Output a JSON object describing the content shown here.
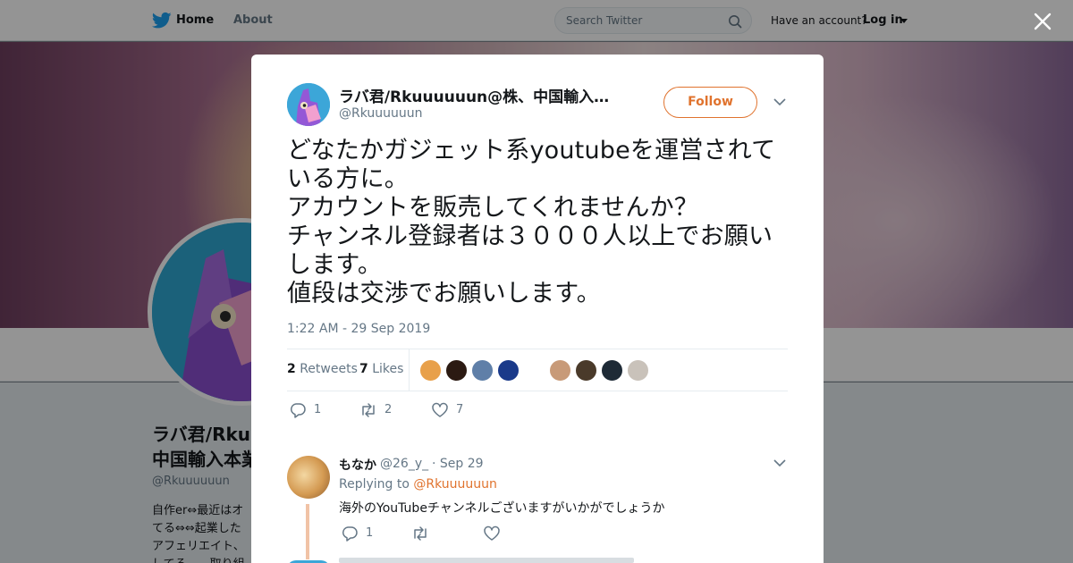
{
  "topbar": {
    "home_label": "Home",
    "about_label": "About",
    "search_placeholder": "Search Twitter",
    "have_account": "Have an account?",
    "login_label": "Log in"
  },
  "profile": {
    "name_line1": "ラバ君/Rkuuuuuun@株、",
    "name_line2": "中国輸入本業",
    "handle": "@Rkuuuuuun",
    "bio_lines": [
      "自作er⇔最近はオ",
      "てる⇔⇔起業した",
      "アフェリエイト、",
      "してる……取り組"
    ]
  },
  "tweet": {
    "author_name": "ラバ君/Rkuuuuuun@株、中国輸入…",
    "author_handle": "@Rkuuuuuun",
    "follow_label": "Follow",
    "text_lines": [
      "どなたかガジェット系youtubeを運営されて",
      "いる方に。",
      "アカウントを販売してくれませんか？",
      "チャンネル登録者は３０００人以上でお願い",
      "します。",
      "値段は交渉でお願いします。"
    ],
    "timestamp": "1:22 AM - 29 Sep 2019",
    "retweets_count": "2",
    "retweets_label": "Retweets",
    "likes_count": "7",
    "likes_label": "Likes",
    "liker_colors": [
      "#e8a04a",
      "#2b1a12",
      "#5f7fa8",
      "#1a3a8a",
      "#ffffff",
      "#c89a78",
      "#4a3a2a",
      "#1e2a36",
      "#c9c2ba"
    ],
    "actions": {
      "reply_count": "1",
      "retweet_count": "2",
      "like_count": "7"
    }
  },
  "reply": {
    "name": "もなか",
    "handle": "@26_y_",
    "date": "· Sep 29",
    "replying_prefix": "Replying to",
    "replying_to": "@Rkuuuuuun",
    "text": "海外のYouTubeチャンネルございますがいかがでしょうか",
    "reply_count": "1"
  }
}
